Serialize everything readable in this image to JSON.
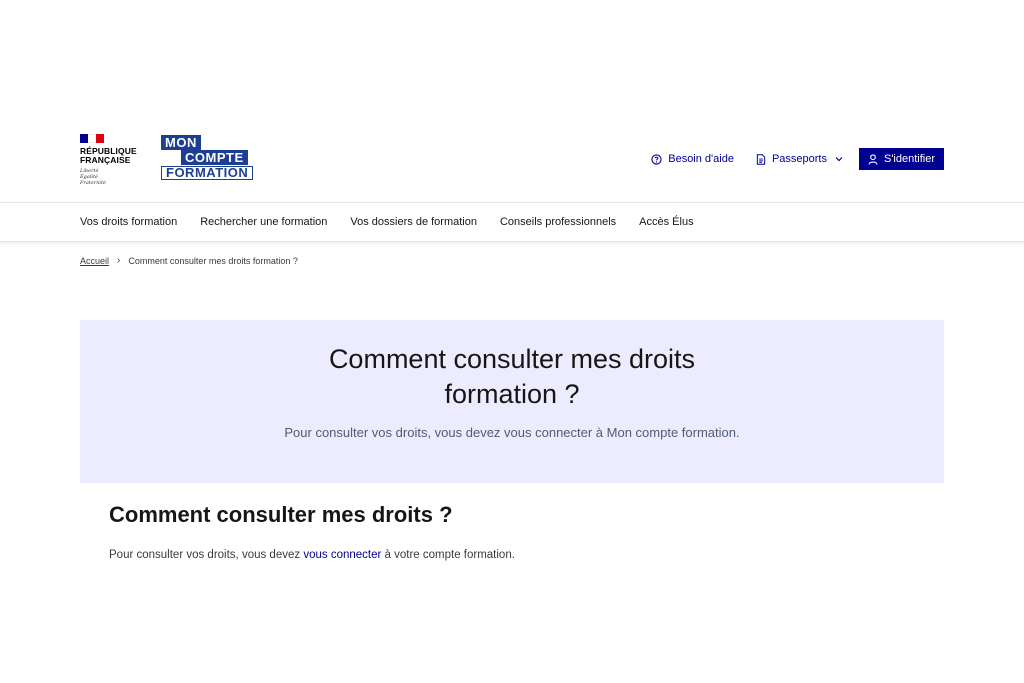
{
  "header": {
    "republique": [
      "RÉPUBLIQUE",
      "FRANÇAISE"
    ],
    "devise": [
      "Liberté",
      "Égalité",
      "Fraternité"
    ],
    "logo_lines": [
      "MON",
      "COMPTE",
      "FORMATION"
    ],
    "help_label": "Besoin d'aide",
    "passports_label": "Passeports",
    "login_label": "S'identifier"
  },
  "nav": {
    "items": [
      "Vos droits formation",
      "Rechercher une formation",
      "Vos dossiers de formation",
      "Conseils professionnels",
      "Accès Élus"
    ]
  },
  "breadcrumb": {
    "home": "Accueil",
    "current": "Comment consulter mes droits formation ?"
  },
  "hero": {
    "title": "Comment consulter mes droits formation ?",
    "subtitle": "Pour consulter vos droits, vous devez vous connecter à Mon compte formation."
  },
  "section": {
    "title": "Comment consulter mes droits ?",
    "body_before": "Pour consulter vos droits, vous devez ",
    "body_link": "vous connecter",
    "body_after": " à votre compte formation."
  },
  "colors": {
    "primary": "#000091",
    "logo_blue": "#1c3f94",
    "hero_bg": "#ececfe",
    "flag_blue": "#000091",
    "flag_white": "#ffffff",
    "flag_red": "#e1000f"
  },
  "icons": {
    "help": "question-circle-icon",
    "passports": "document-icon",
    "chevron": "chevron-down-icon",
    "user": "user-icon",
    "separator": "chevron-right-icon"
  }
}
